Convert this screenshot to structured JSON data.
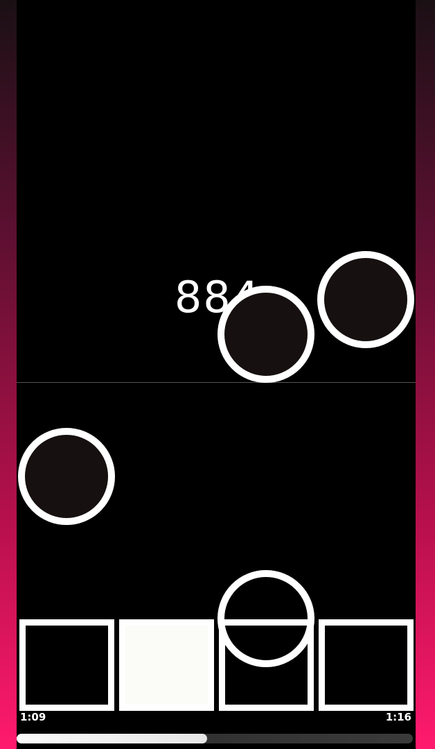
{
  "game": {
    "score": "884",
    "time_elapsed": "1:09",
    "time_total": "1:16",
    "progress": 0.48,
    "lanes": [
      {
        "active": false
      },
      {
        "active": true
      },
      {
        "active": false
      },
      {
        "active": false
      }
    ]
  },
  "colors": {
    "side_gradient_bottom": "#ff1a6e",
    "note_fill": "#161010",
    "note_ring": "#ffffff"
  }
}
